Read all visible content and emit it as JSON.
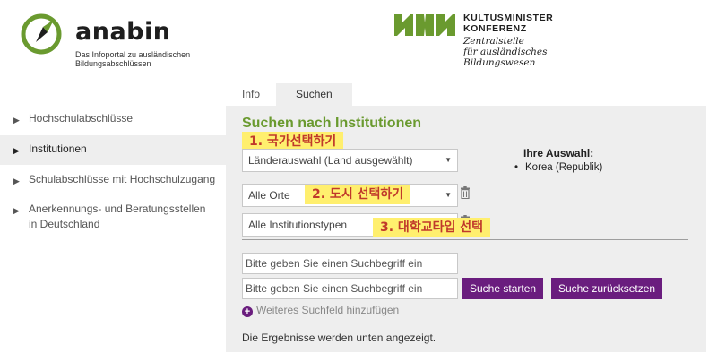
{
  "header": {
    "anabin_title": "anabin",
    "anabin_subtitle_line1": "Das Infoportal zu ausländischen",
    "anabin_subtitle_line2": "Bildungsabschlüssen",
    "kmk_title_line1": "KULTUSMINISTER",
    "kmk_title_line2": "KONFERENZ",
    "kmk_sub_line1": "Zentralstelle",
    "kmk_sub_line2": "für ausländisches",
    "kmk_sub_line3": "Bildungswesen",
    "brand_green": "#6a9a2f"
  },
  "tabs": [
    {
      "label": "Info"
    },
    {
      "label": "Suchen",
      "active": true
    }
  ],
  "sidebar": {
    "items": [
      {
        "label": "Hochschulabschlüsse"
      },
      {
        "label": "Institutionen",
        "active": true
      },
      {
        "label": "Schulabschlüsse mit Hochschulzugang"
      },
      {
        "label": "Anerkennungs- und Beratungsstellen in Deutschland"
      }
    ]
  },
  "main": {
    "title": "Suchen nach Institutionen",
    "country_select": "Länderauswahl (Land ausgewählt)",
    "city_select": "Alle Orte",
    "type_select": "Alle Institutionstypen",
    "selection_label": "Ihre Auswahl:",
    "selection_items": [
      "Korea (Republik)"
    ],
    "search_placeholder_1": "Bitte geben Sie einen Suchbegriff ein",
    "search_placeholder_2": "Bitte geben Sie einen Suchbegriff ein",
    "search_button": "Suche starten",
    "reset_button": "Suche zurücksetzen",
    "add_field": "Weiteres Suchfeld hinzufügen",
    "results_note": "Die Ergebnisse werden unten angezeigt.",
    "button_color": "#6a1d7e"
  },
  "annotations": {
    "step1": "1. 국가선택하기",
    "step2": "2. 도시 선택하기",
    "step3": "3. 대학교타입 선택"
  }
}
